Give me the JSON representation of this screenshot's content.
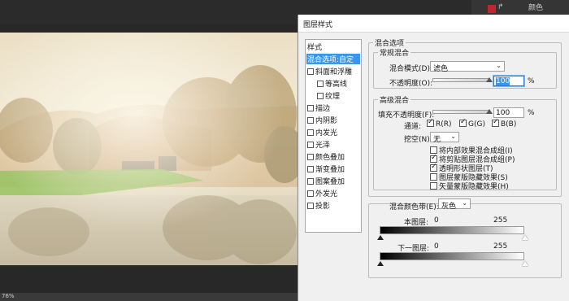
{
  "workspace": {
    "tab_label": "颜色",
    "tool_icon_text": "↱",
    "status_zoom": "76%"
  },
  "dialog": {
    "title": "图层样式",
    "styles_header": "样式",
    "styles": [
      {
        "label": "混合选项:自定",
        "checkbox": false,
        "selected": true,
        "indent": false
      },
      {
        "label": "斜面和浮雕",
        "checkbox": true,
        "checked": false,
        "indent": false
      },
      {
        "label": "等高线",
        "checkbox": true,
        "checked": false,
        "indent": true
      },
      {
        "label": "纹理",
        "checkbox": true,
        "checked": false,
        "indent": true
      },
      {
        "label": "描边",
        "checkbox": true,
        "checked": false,
        "indent": false
      },
      {
        "label": "内阴影",
        "checkbox": true,
        "checked": false,
        "indent": false
      },
      {
        "label": "内发光",
        "checkbox": true,
        "checked": false,
        "indent": false
      },
      {
        "label": "光泽",
        "checkbox": true,
        "checked": false,
        "indent": false
      },
      {
        "label": "颜色叠加",
        "checkbox": true,
        "checked": false,
        "indent": false
      },
      {
        "label": "渐变叠加",
        "checkbox": true,
        "checked": false,
        "indent": false
      },
      {
        "label": "图案叠加",
        "checkbox": true,
        "checked": false,
        "indent": false
      },
      {
        "label": "外发光",
        "checkbox": true,
        "checked": false,
        "indent": false
      },
      {
        "label": "投影",
        "checkbox": true,
        "checked": false,
        "indent": false
      }
    ],
    "blend_options": {
      "section_title": "混合选项",
      "general": {
        "title": "常规混合",
        "mode_label": "混合模式(D):",
        "mode_value": "滤色",
        "opacity_label": "不透明度(O):",
        "opacity_value": "100",
        "opacity_unit": "%",
        "opacity_fraction": 1.0
      },
      "advanced": {
        "title": "高级混合",
        "fill_label": "填充不透明度(F):",
        "fill_value": "100",
        "fill_unit": "%",
        "fill_fraction": 1.0,
        "channels_label": "通道:",
        "channels": [
          {
            "label": "R(R)",
            "checked": true
          },
          {
            "label": "G(G)",
            "checked": true
          },
          {
            "label": "B(B)",
            "checked": true
          }
        ],
        "knockout_label": "挖空(N):",
        "knockout_value": "无",
        "options": [
          {
            "label": "将内部效果混合成组(I)",
            "checked": false
          },
          {
            "label": "将剪贴图层混合成组(P)",
            "checked": true
          },
          {
            "label": "透明形状图层(T)",
            "checked": true
          },
          {
            "label": "图层蒙版隐藏效果(S)",
            "checked": false
          },
          {
            "label": "矢量蒙版隐藏效果(H)",
            "checked": false
          }
        ]
      },
      "blend_if": {
        "label": "混合颜色带(E):",
        "value": "灰色",
        "this_layer_label": "本图层:",
        "this_layer_min": "0",
        "this_layer_max": "255",
        "underlying_label": "下一图层:",
        "underlying_min": "0",
        "underlying_max": "255"
      }
    }
  }
}
